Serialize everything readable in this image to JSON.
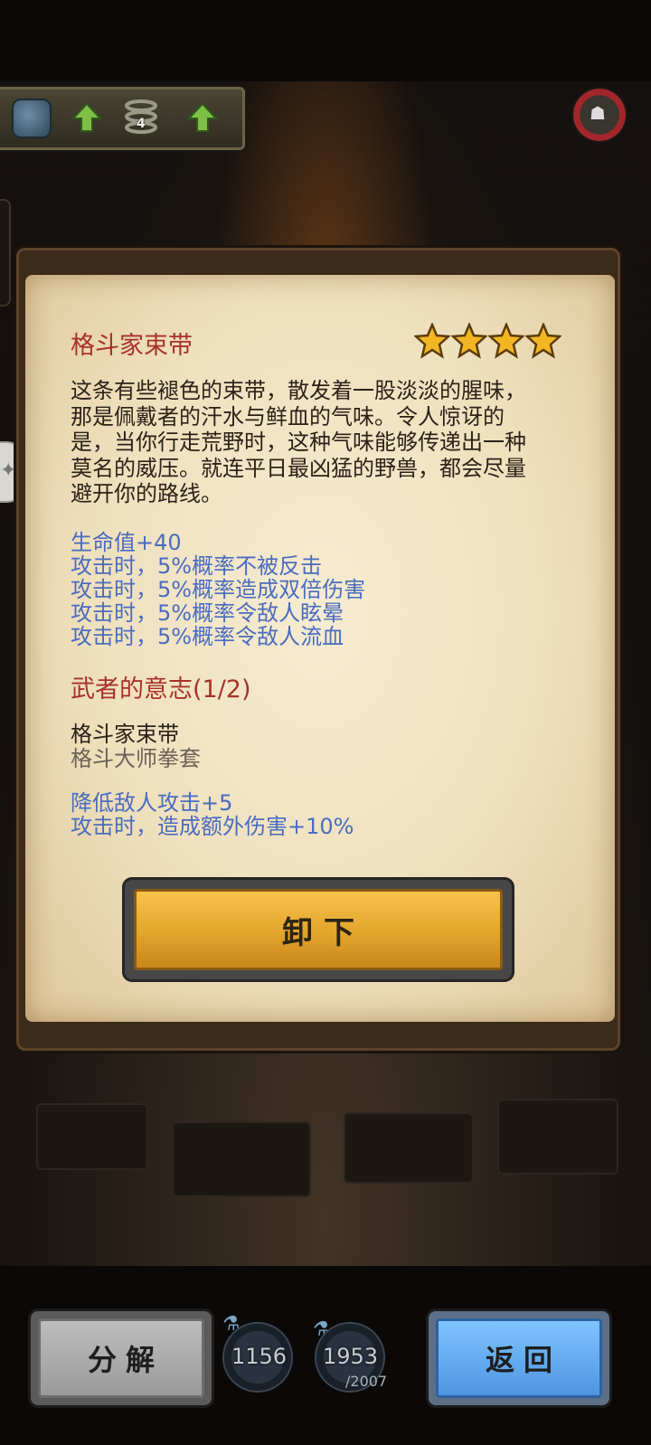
{
  "top_bar": {
    "coil_count": "4"
  },
  "item": {
    "name": "格斗家束带",
    "stars": 4,
    "description": "这条有些褪色的束带，散发着一股淡淡的腥味，那是佩戴者的汗水与鲜血的气味。令人惊讶的是，当你行走荒野时，这种气味能够传递出一种莫名的威压。就连平日最凶猛的野兽，都会尽量避开你的路线。",
    "stats": [
      "生命值+40",
      "攻击时，5%概率不被反击",
      "攻击时，5%概率造成双倍伤害",
      "攻击时，5%概率令敌人眩晕",
      "攻击时，5%概率令敌人流血"
    ]
  },
  "set": {
    "title": "武者的意志(1/2)",
    "pieces": [
      {
        "name": "格斗家束带",
        "owned": true
      },
      {
        "name": "格斗大师拳套",
        "owned": false
      }
    ],
    "bonuses": [
      "降低敌人攻击+5",
      "攻击时，造成额外伤害+10%"
    ]
  },
  "actions": {
    "unequip_label": "卸下",
    "decompose_label": "分解",
    "back_label": "返回"
  },
  "resources": {
    "first_value": "1156",
    "second_value": "1953",
    "second_max": "/2007"
  },
  "colors": {
    "title_red": "#a8322a",
    "stat_blue": "#4a6cc0",
    "button_gold": "#e3a52b",
    "button_blue": "#4e95e2"
  }
}
